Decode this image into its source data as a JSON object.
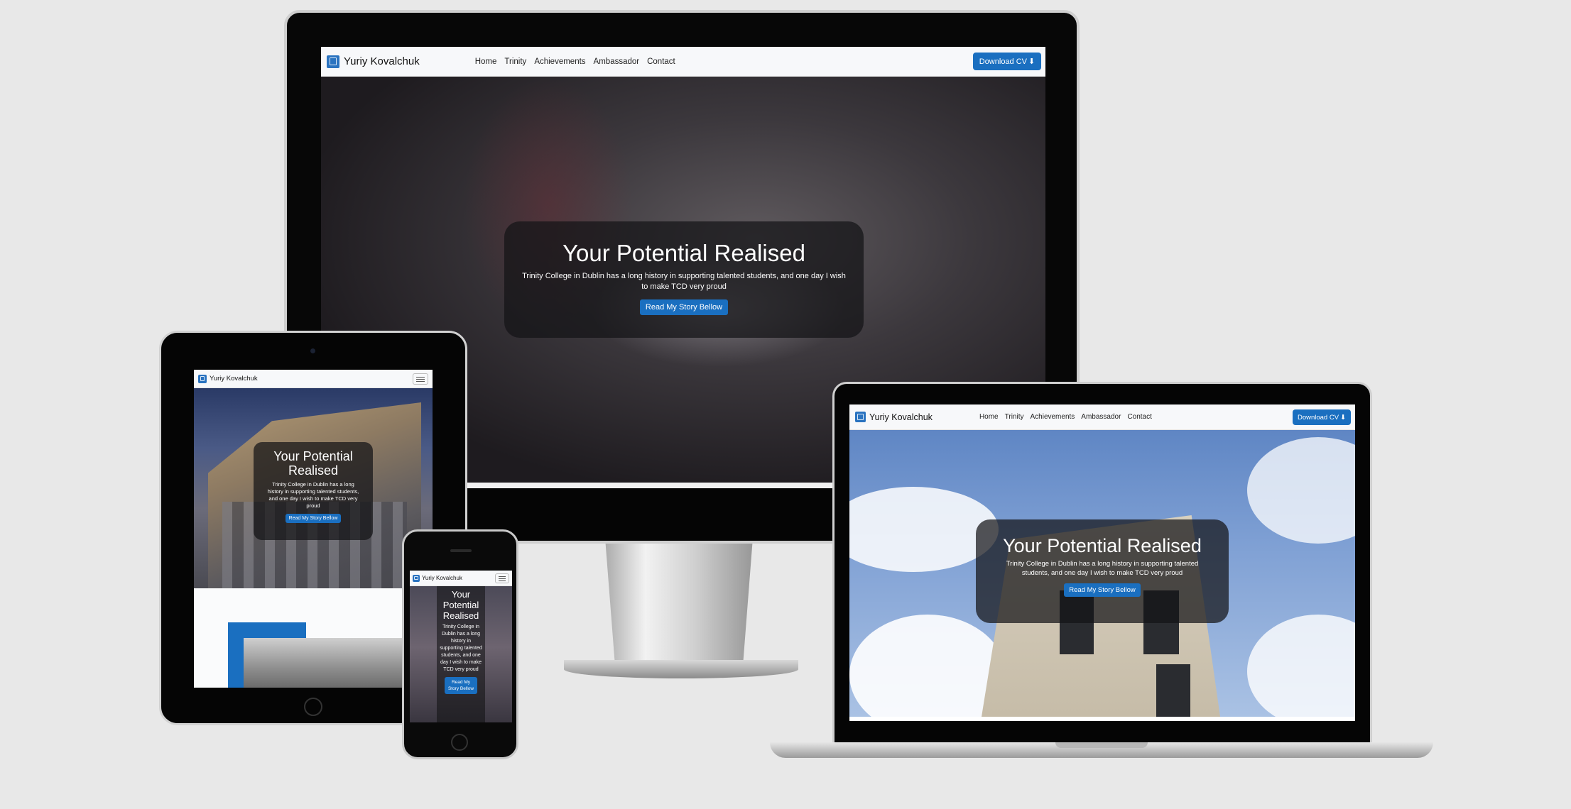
{
  "site": {
    "brand": "Yuriy Kovalchuk",
    "nav": [
      "Home",
      "Trinity",
      "Achievements",
      "Ambassador",
      "Contact"
    ],
    "download_button": "Download CV",
    "hero_title": "Your Potential Realised",
    "hero_text": "Trinity College in Dublin has a long history in supporting talented students, and one day I wish to make TCD very proud",
    "hero_button": "Read My Story Bellow"
  },
  "icons": {
    "logo": "crest-icon",
    "download": "download-icon",
    "menu": "hamburger-menu-icon"
  },
  "colors": {
    "background": "#e8e8e8",
    "accent_blue": "#1a6fc0",
    "navbar": "#f7f8fa"
  }
}
